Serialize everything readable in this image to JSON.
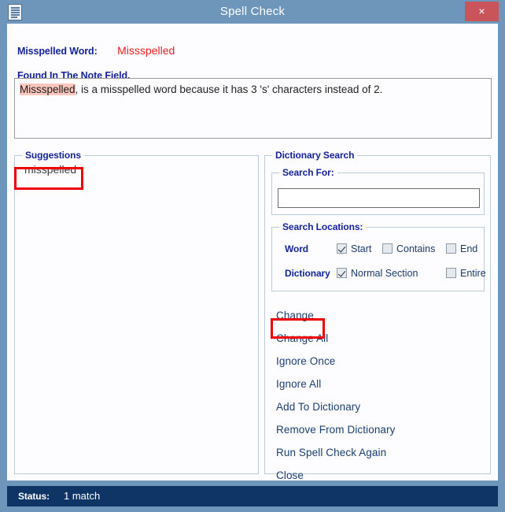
{
  "window": {
    "title": "Spell Check",
    "icon": "document-icon",
    "close_label": "×",
    "titlebar_color": "#6e96bb",
    "accent_color": "#14239c",
    "close_color": "#c9545a"
  },
  "header": {
    "misspelled_label": "Misspelled Word:",
    "misspelled_value": "Missspelled",
    "misspelled_value_color": "#ef2020",
    "note_label": "Found In The Note Field."
  },
  "note_field": {
    "highlighted_word": "Missspelled",
    "highlight_color": "#ffc7bd",
    "rest_text": ", is a misspelled word because it has 3 's' characters instead of 2."
  },
  "suggestions": {
    "title": "Suggestions",
    "items": [
      {
        "label": "misspelled"
      }
    ]
  },
  "dictionary_search": {
    "title": "Dictionary Search",
    "search_for": {
      "title": "Search For:",
      "value": "",
      "placeholder": ""
    },
    "search_locations": {
      "title": "Search Locations:",
      "rows": [
        {
          "label": "Word",
          "options": [
            {
              "label": "Start",
              "checked": true
            },
            {
              "label": "Contains",
              "checked": false
            },
            {
              "label": "End",
              "checked": false
            }
          ]
        },
        {
          "label": "Dictionary",
          "options": [
            {
              "label": "Normal Section",
              "checked": true
            },
            {
              "label": "Entire",
              "checked": false
            }
          ]
        }
      ]
    }
  },
  "actions": [
    {
      "label": "Change"
    },
    {
      "label": "Change All"
    },
    {
      "label": "Ignore Once"
    },
    {
      "label": "Ignore All"
    },
    {
      "label": "Add To Dictionary"
    },
    {
      "label": "Remove From Dictionary"
    },
    {
      "label": "Run Spell Check Again"
    },
    {
      "label": "Close"
    }
  ],
  "annotations": {
    "color": "#ef0000",
    "targets": [
      "suggestion-item-misspelled",
      "action-link-change"
    ]
  },
  "statusbar": {
    "label": "Status:",
    "value": "1 match",
    "background": "#0f3566"
  }
}
